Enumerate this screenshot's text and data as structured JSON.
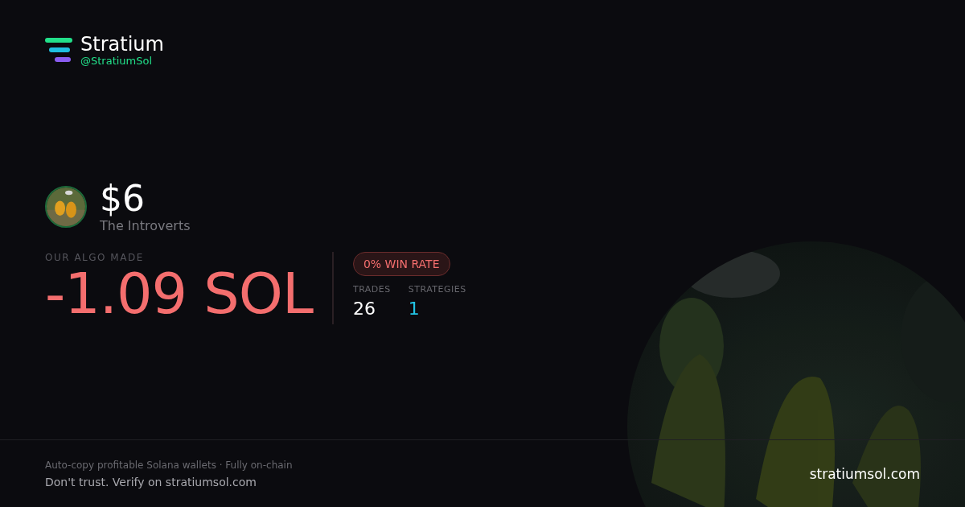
{
  "brand": {
    "name": "Stratium",
    "handle": "@StratiumSol"
  },
  "token": {
    "ticker": "$6",
    "name": "The Introverts"
  },
  "result": {
    "label": "OUR ALGO MADE",
    "amount": "-1.09 SOL",
    "win_rate": "0% WIN RATE"
  },
  "stats": [
    {
      "label": "TRADES",
      "value": "26",
      "color": "#ffffff"
    },
    {
      "label": "STRATEGIES",
      "value": "1",
      "color": "#22c5e6"
    }
  ],
  "footer": {
    "tagline": "Auto-copy profitable Solana wallets · Fully on-chain",
    "verify": "Don't trust. Verify on stratiumsol.com",
    "site": "stratiumsol.com"
  }
}
